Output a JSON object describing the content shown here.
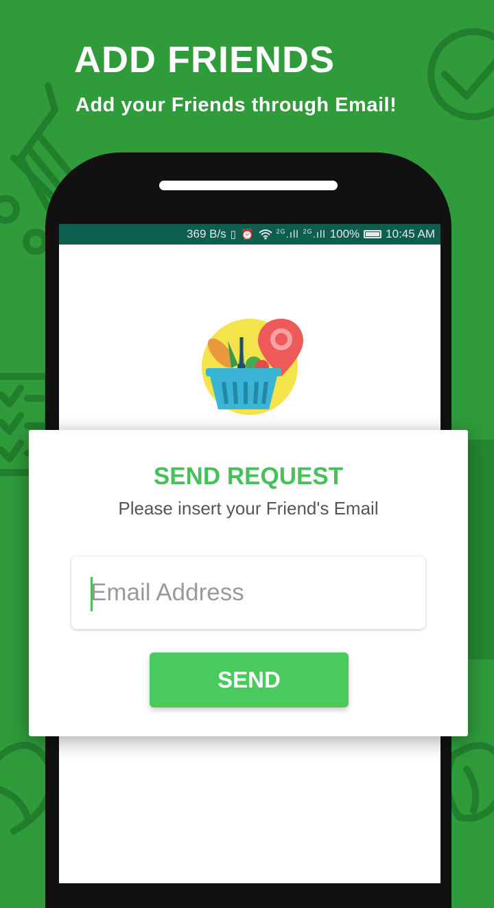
{
  "promo": {
    "title": "ADD FRIENDS",
    "subtitle": "Add your Friends through Email!"
  },
  "statusbar": {
    "speed": "369 B/s",
    "battery": "100%",
    "time": "10:45 AM",
    "network_1": "2G",
    "network_2": "2G"
  },
  "dialog": {
    "title": "SEND REQUEST",
    "subtitle": "Please insert your Friend's Email",
    "email_placeholder": "Email Address",
    "email_value": "",
    "send_label": "SEND"
  },
  "colors": {
    "background": "#2f9b3b",
    "accent": "#46c15a",
    "button": "#4ac95d",
    "statusbar": "#0d5e4f"
  },
  "icons": [
    "checkmark-circle-icon",
    "shopping-cart-icon",
    "checklist-icon",
    "grocery-basket-logo",
    "location-pin-icon",
    "wifi-icon",
    "alarm-icon",
    "vibrate-icon",
    "signal-icon",
    "battery-icon"
  ]
}
